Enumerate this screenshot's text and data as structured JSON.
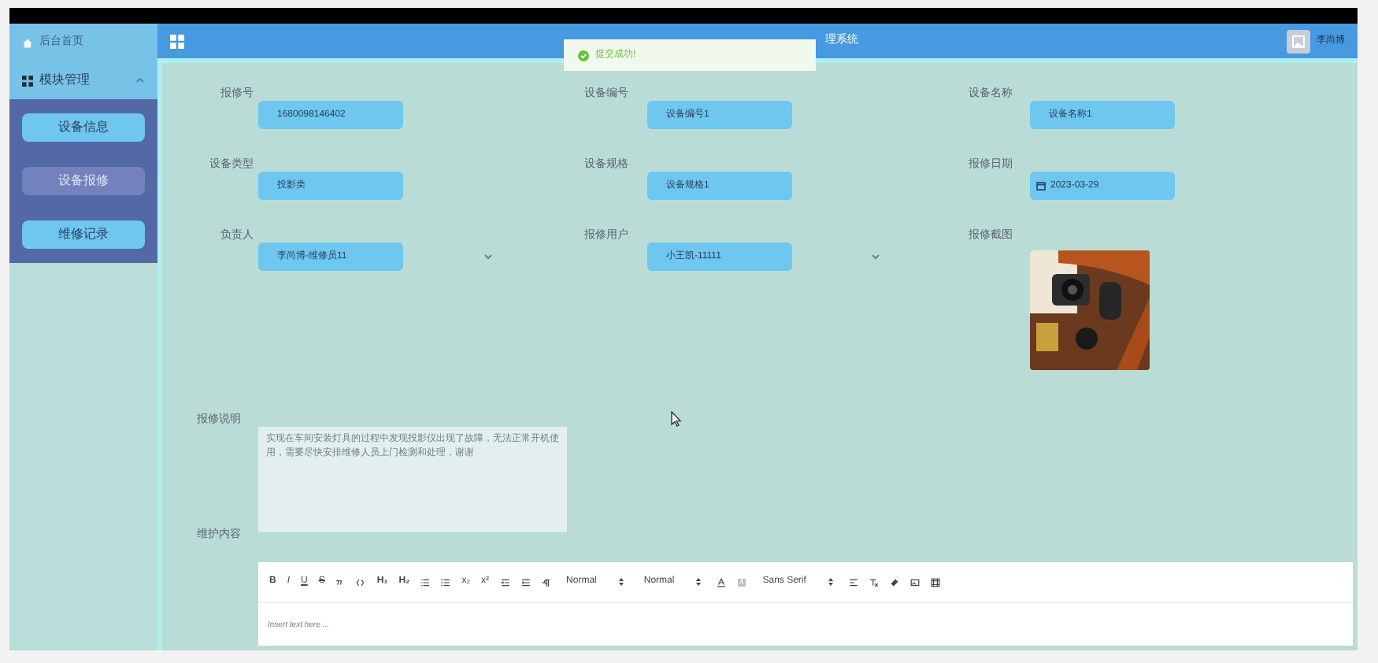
{
  "header": {
    "title": "理系统",
    "user": "李尚博"
  },
  "toast": {
    "text": "提交成功!"
  },
  "sidebar": {
    "home": "后台首页",
    "group": {
      "label": "模块管理",
      "expanded": true
    },
    "items": [
      {
        "label": "设备信息",
        "selected": false
      },
      {
        "label": "设备报修",
        "selected": true
      },
      {
        "label": "维修记录",
        "selected": false
      }
    ]
  },
  "form": {
    "fields": [
      {
        "label": "报修号",
        "value": "1680098146402",
        "kind": "text"
      },
      {
        "label": "设备编号",
        "value": "设备编号1",
        "kind": "text"
      },
      {
        "label": "设备名称",
        "value": "设备名称1",
        "kind": "text"
      },
      {
        "label": "设备类型",
        "value": "投影类",
        "kind": "text"
      },
      {
        "label": "设备规格",
        "value": "设备规格1",
        "kind": "text"
      },
      {
        "label": "报修日期",
        "value": "2023-03-29",
        "kind": "date"
      },
      {
        "label": "负责人",
        "value": "李尚博-维修员11",
        "kind": "select"
      },
      {
        "label": "报修用户",
        "value": "小王凯-11111",
        "kind": "select"
      },
      {
        "label": "报修截图",
        "kind": "picture"
      }
    ],
    "description": {
      "label": "报修说明",
      "placeholder": "实现在车间安装灯具的过程中发现投影仪出现了故障，无法正常开机使用，需要尽快安排维修人员上门检测和处理，谢谢"
    },
    "content": {
      "label": "维护内容",
      "placeholder": "Insert text here ...",
      "buttons": [
        "B",
        "I",
        "U",
        "S",
        "H₁",
        "H₂",
        "x₂",
        "x²"
      ],
      "pickers": [
        "Normal",
        "Normal",
        "Sans Serif"
      ]
    }
  }
}
